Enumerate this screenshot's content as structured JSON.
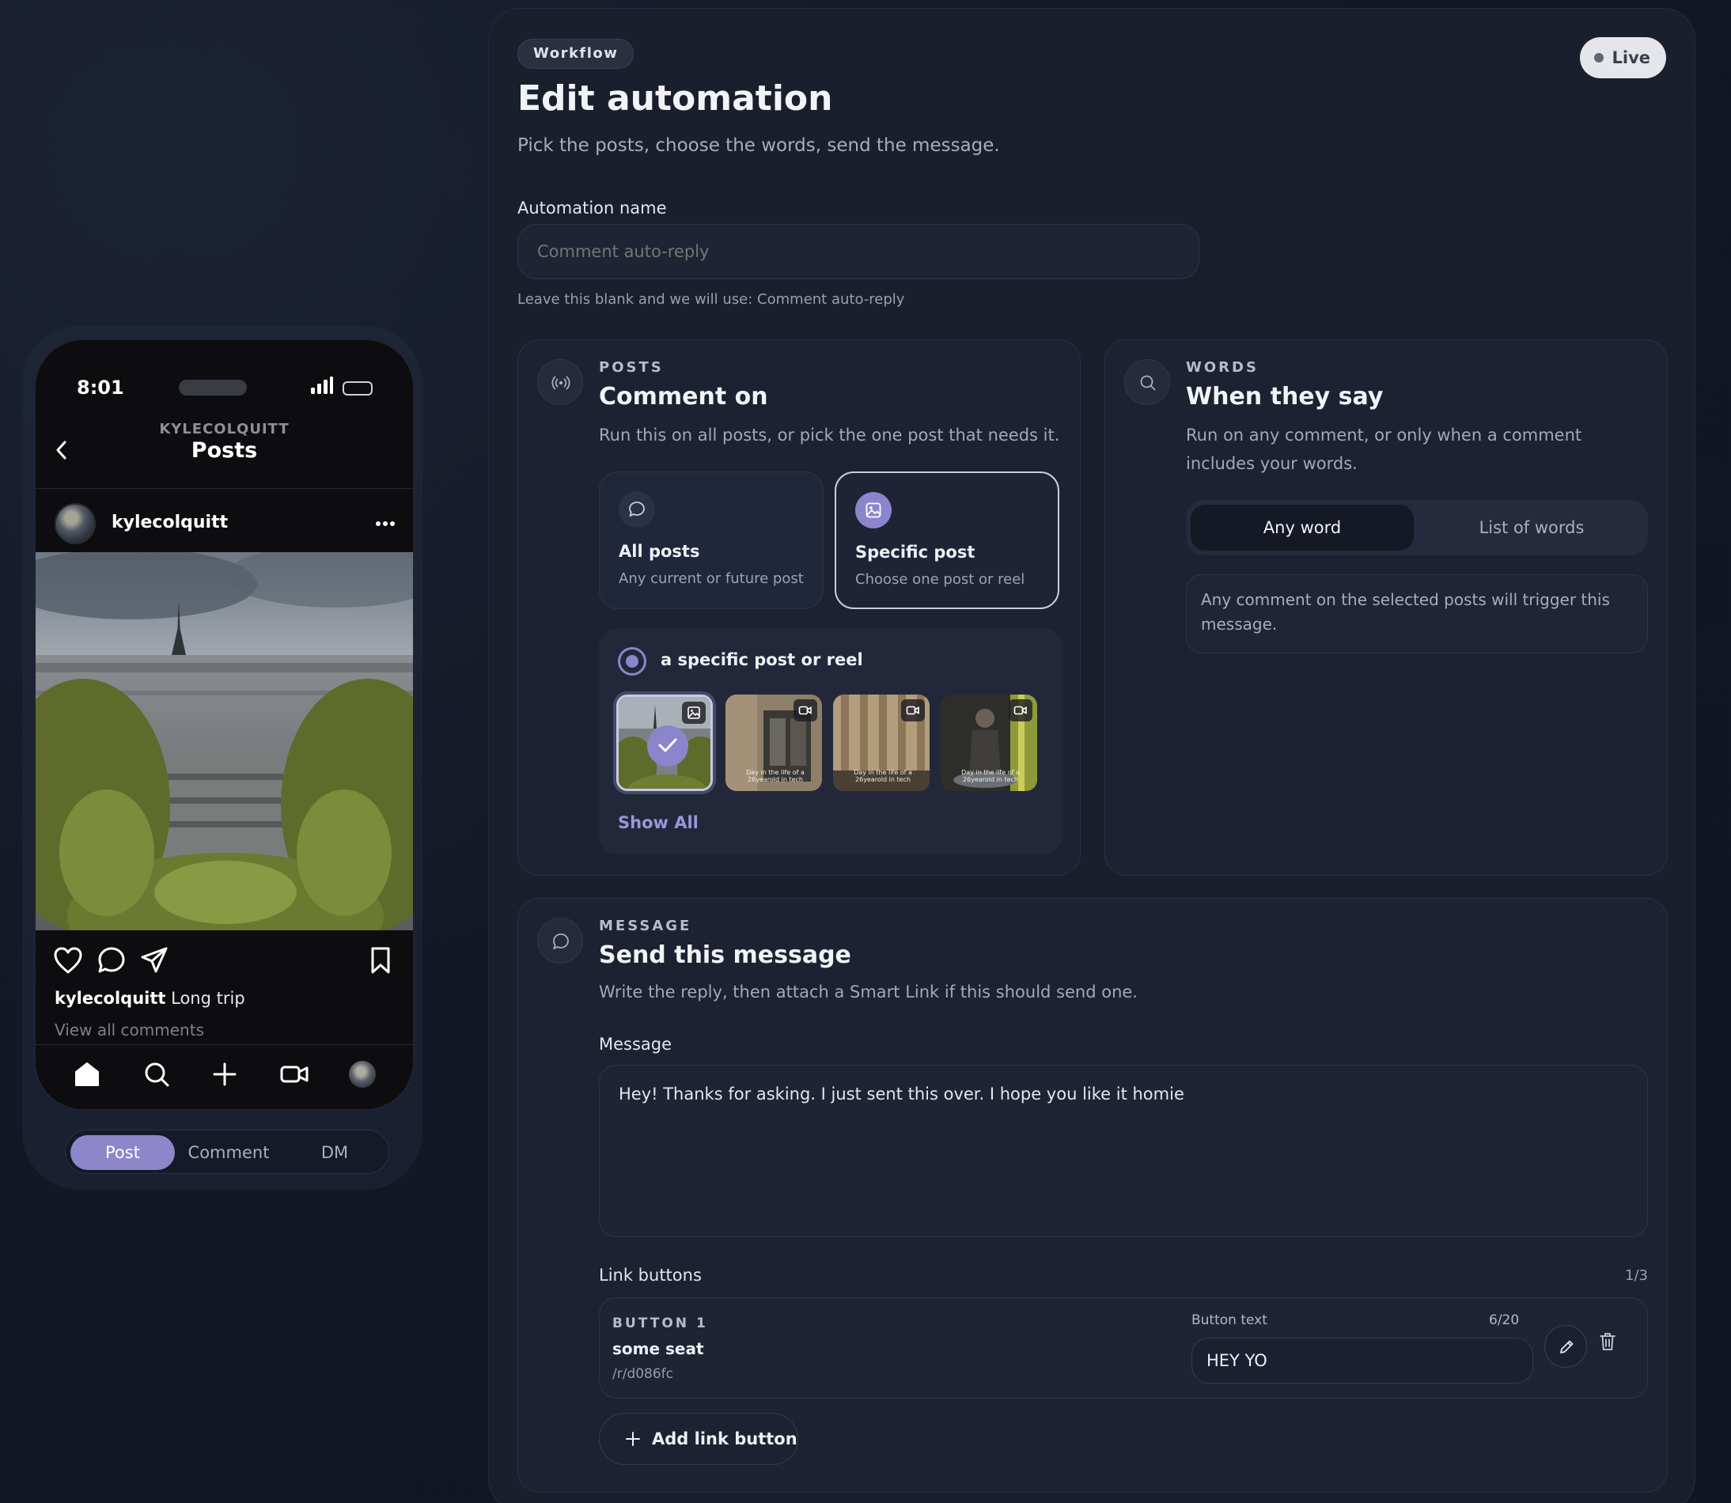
{
  "phone": {
    "time": "8:01",
    "header_sub": "KYLECOLQUITT",
    "header_title": "Posts",
    "post_user": "kylecolquitt",
    "caption_user": "kylecolquitt",
    "caption_text": "Long trip",
    "view_comments": "View all comments",
    "tabs": {
      "post": "Post",
      "comment": "Comment",
      "dm": "DM"
    }
  },
  "workflow": {
    "chip": "Workflow",
    "status": "Live",
    "title": "Edit automation",
    "subtitle": "Pick the posts, choose the words, send the message.",
    "name_label": "Automation name",
    "name_placeholder": "Comment auto-reply",
    "name_hint": "Leave this blank and we will use: Comment auto-reply"
  },
  "posts_card": {
    "eyebrow": "POSTS",
    "title": "Comment on",
    "desc": "Run this on all posts, or pick the one post that needs it.",
    "options": [
      {
        "title": "All posts",
        "sub": "Any current or future post"
      },
      {
        "title": "Specific post",
        "sub": "Choose one post or reel"
      }
    ],
    "picker_label": "a specific post or reel",
    "thumb_caption": "Day in the life of a 26yearold in tech",
    "show_all": "Show All"
  },
  "words_card": {
    "eyebrow": "WORDS",
    "title": "When they say",
    "desc": "Run on any comment, or only when a comment includes your words.",
    "toggle": {
      "any": "Any word",
      "list": "List of words"
    },
    "info": "Any comment on the selected posts will trigger this message."
  },
  "message_card": {
    "eyebrow": "MESSAGE",
    "title": "Send this message",
    "desc": "Write the reply, then attach a Smart Link if this should send one.",
    "message_label": "Message",
    "message_text": "Hey! Thanks for asking. I just sent this over. I hope you like it homie",
    "link_label": "Link buttons",
    "link_count": "1/3",
    "button": {
      "eyebrow": "BUTTON 1",
      "name": "some seat",
      "url": "/r/d086fc",
      "text_label": "Button text",
      "text_count": "6/20",
      "text_value": "HEY YO"
    },
    "add_button": "Add link button"
  },
  "colors": {
    "accent": "#8c85cc",
    "panel": "#1a1f2d",
    "background": "#131826"
  }
}
